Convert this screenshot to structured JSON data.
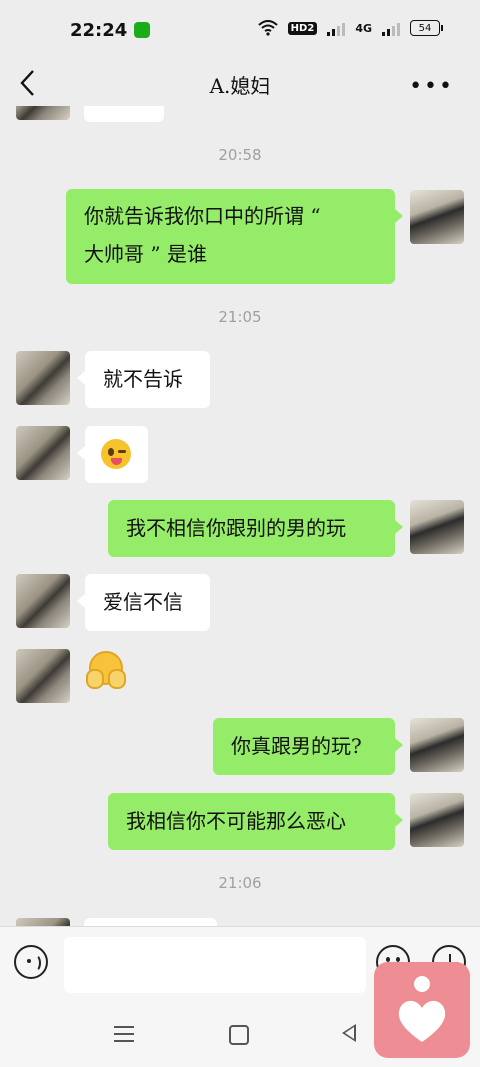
{
  "status_bar": {
    "time": "22:24",
    "net1": "HD",
    "net1_sub": "2",
    "net2": "4G",
    "battery": "54"
  },
  "header": {
    "title": "A.媳妇"
  },
  "times": {
    "t1": "20:58",
    "t2": "21:05",
    "t3": "21:06"
  },
  "messages": [
    {
      "sender": "me",
      "text_line1": "你就告诉我你口中的所谓 “",
      "text_line2": "大帅哥 ” 是谁"
    },
    {
      "sender": "her",
      "text": "就不告诉"
    },
    {
      "sender": "her",
      "emoji": "wink-tongue-emoji"
    },
    {
      "sender": "me",
      "text": "我不相信你跟别的男的玩"
    },
    {
      "sender": "her",
      "text": "爱信不信"
    },
    {
      "sender": "her",
      "emoji": "shush-emoji"
    },
    {
      "sender": "me",
      "text": "你真跟男的玩?"
    },
    {
      "sender": "me",
      "text": "我相信你不可能那么恶心"
    }
  ],
  "input": {
    "placeholder": ""
  },
  "colors": {
    "accent_bubble": "#95ec69",
    "background": "#ededed",
    "float_app": "#ee8d93"
  }
}
